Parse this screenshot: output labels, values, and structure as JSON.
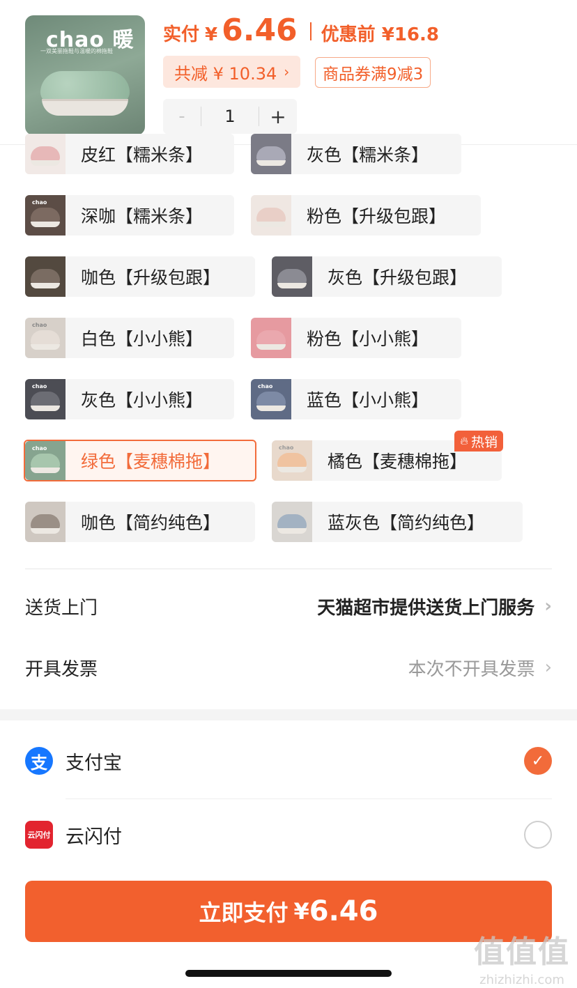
{
  "header": {
    "thumb_brand": "chao 暖",
    "thumb_sub": "一双美丽拖鞋与温暖的棉拖鞋",
    "paid_label": "实付",
    "yen": "¥",
    "paid_price": "6.46",
    "original_label": "优惠前 ¥16.8",
    "saving_label": "共减 ¥ 10.34",
    "saving_arrow": "›",
    "coupon_label": "商品券满9减3",
    "stepper": {
      "minus": "-",
      "quantity": "1",
      "plus": "+"
    }
  },
  "options": [
    {
      "label": "皮红【糯米条】",
      "color": "#e7b8b8",
      "selected": false
    },
    {
      "label": "灰色【糯米条】",
      "color": "#a9a9b6",
      "selected": false
    },
    {
      "label": "深咖【糯米条】",
      "color": "#7c6a61",
      "selected": false
    },
    {
      "label": "粉色【升级包跟】",
      "color": "#e9cfc7",
      "selected": false
    },
    {
      "label": "咖色【升级包跟】",
      "color": "#7a6c62",
      "selected": false
    },
    {
      "label": "灰色【升级包跟】",
      "color": "#8b8b93",
      "selected": false
    },
    {
      "label": "白色【小小熊】",
      "color": "#e5ddd6",
      "selected": false
    },
    {
      "label": "粉色【小小熊】",
      "color": "#eaa8ae",
      "selected": false
    },
    {
      "label": "灰色【小小熊】",
      "color": "#6c6d74",
      "selected": false
    },
    {
      "label": "蓝色【小小熊】",
      "color": "#7d8aa5",
      "selected": false
    },
    {
      "label": "绿色【麦穗棉拖】",
      "color": "#a7c6ad",
      "selected": true
    },
    {
      "label": "橘色【麦穗棉拖】",
      "color": "#f0c3a0",
      "selected": false,
      "badge": "热销"
    },
    {
      "label": "咖色【简约纯色】",
      "color": "#9a8f86",
      "selected": false
    },
    {
      "label": "蓝灰色【简约纯色】",
      "color": "#a3b2c2",
      "selected": false
    }
  ],
  "delivery": {
    "label": "送货上门",
    "value": "天猫超市提供送货上门服务",
    "chevron": "›"
  },
  "invoice": {
    "label": "开具发票",
    "value": "本次不开具发票",
    "chevron": "›"
  },
  "payment": {
    "alipay": {
      "name": "支付宝",
      "icon": "alipay-icon",
      "icon_text": "支",
      "checked": true,
      "check_mark": "✓"
    },
    "unionpay": {
      "name": "云闪付",
      "icon": "unionpay-icon",
      "icon_text": "云闪付",
      "checked": false
    }
  },
  "pay_button": {
    "text": "立即支付",
    "yen": "¥",
    "amount": "6.46"
  },
  "watermark": {
    "top": "值值值",
    "bottom": "zhizhizhi.com"
  },
  "colors": {
    "accent": "#f2602e",
    "accent_light": "#fde7de",
    "alipay_blue": "#1677ff",
    "unionpay_red": "#e2242f"
  }
}
